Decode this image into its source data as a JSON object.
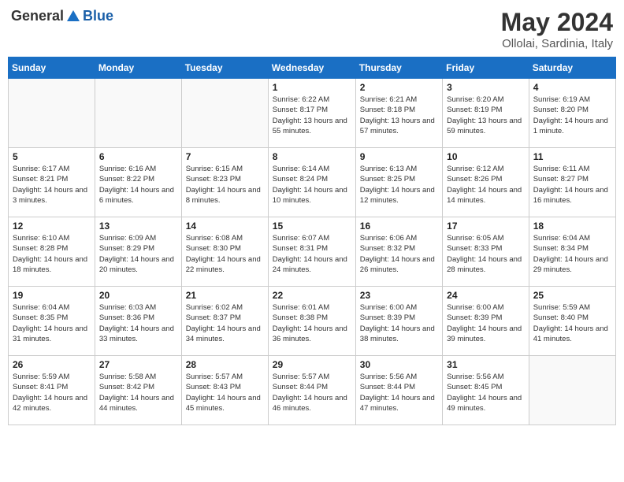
{
  "header": {
    "logo_general": "General",
    "logo_blue": "Blue",
    "month_year": "May 2024",
    "location": "Ollolai, Sardinia, Italy"
  },
  "weekdays": [
    "Sunday",
    "Monday",
    "Tuesday",
    "Wednesday",
    "Thursday",
    "Friday",
    "Saturday"
  ],
  "weeks": [
    [
      null,
      null,
      null,
      {
        "day": "1",
        "sunrise": "Sunrise: 6:22 AM",
        "sunset": "Sunset: 8:17 PM",
        "daylight": "Daylight: 13 hours and 55 minutes."
      },
      {
        "day": "2",
        "sunrise": "Sunrise: 6:21 AM",
        "sunset": "Sunset: 8:18 PM",
        "daylight": "Daylight: 13 hours and 57 minutes."
      },
      {
        "day": "3",
        "sunrise": "Sunrise: 6:20 AM",
        "sunset": "Sunset: 8:19 PM",
        "daylight": "Daylight: 13 hours and 59 minutes."
      },
      {
        "day": "4",
        "sunrise": "Sunrise: 6:19 AM",
        "sunset": "Sunset: 8:20 PM",
        "daylight": "Daylight: 14 hours and 1 minute."
      }
    ],
    [
      {
        "day": "5",
        "sunrise": "Sunrise: 6:17 AM",
        "sunset": "Sunset: 8:21 PM",
        "daylight": "Daylight: 14 hours and 3 minutes."
      },
      {
        "day": "6",
        "sunrise": "Sunrise: 6:16 AM",
        "sunset": "Sunset: 8:22 PM",
        "daylight": "Daylight: 14 hours and 6 minutes."
      },
      {
        "day": "7",
        "sunrise": "Sunrise: 6:15 AM",
        "sunset": "Sunset: 8:23 PM",
        "daylight": "Daylight: 14 hours and 8 minutes."
      },
      {
        "day": "8",
        "sunrise": "Sunrise: 6:14 AM",
        "sunset": "Sunset: 8:24 PM",
        "daylight": "Daylight: 14 hours and 10 minutes."
      },
      {
        "day": "9",
        "sunrise": "Sunrise: 6:13 AM",
        "sunset": "Sunset: 8:25 PM",
        "daylight": "Daylight: 14 hours and 12 minutes."
      },
      {
        "day": "10",
        "sunrise": "Sunrise: 6:12 AM",
        "sunset": "Sunset: 8:26 PM",
        "daylight": "Daylight: 14 hours and 14 minutes."
      },
      {
        "day": "11",
        "sunrise": "Sunrise: 6:11 AM",
        "sunset": "Sunset: 8:27 PM",
        "daylight": "Daylight: 14 hours and 16 minutes."
      }
    ],
    [
      {
        "day": "12",
        "sunrise": "Sunrise: 6:10 AM",
        "sunset": "Sunset: 8:28 PM",
        "daylight": "Daylight: 14 hours and 18 minutes."
      },
      {
        "day": "13",
        "sunrise": "Sunrise: 6:09 AM",
        "sunset": "Sunset: 8:29 PM",
        "daylight": "Daylight: 14 hours and 20 minutes."
      },
      {
        "day": "14",
        "sunrise": "Sunrise: 6:08 AM",
        "sunset": "Sunset: 8:30 PM",
        "daylight": "Daylight: 14 hours and 22 minutes."
      },
      {
        "day": "15",
        "sunrise": "Sunrise: 6:07 AM",
        "sunset": "Sunset: 8:31 PM",
        "daylight": "Daylight: 14 hours and 24 minutes."
      },
      {
        "day": "16",
        "sunrise": "Sunrise: 6:06 AM",
        "sunset": "Sunset: 8:32 PM",
        "daylight": "Daylight: 14 hours and 26 minutes."
      },
      {
        "day": "17",
        "sunrise": "Sunrise: 6:05 AM",
        "sunset": "Sunset: 8:33 PM",
        "daylight": "Daylight: 14 hours and 28 minutes."
      },
      {
        "day": "18",
        "sunrise": "Sunrise: 6:04 AM",
        "sunset": "Sunset: 8:34 PM",
        "daylight": "Daylight: 14 hours and 29 minutes."
      }
    ],
    [
      {
        "day": "19",
        "sunrise": "Sunrise: 6:04 AM",
        "sunset": "Sunset: 8:35 PM",
        "daylight": "Daylight: 14 hours and 31 minutes."
      },
      {
        "day": "20",
        "sunrise": "Sunrise: 6:03 AM",
        "sunset": "Sunset: 8:36 PM",
        "daylight": "Daylight: 14 hours and 33 minutes."
      },
      {
        "day": "21",
        "sunrise": "Sunrise: 6:02 AM",
        "sunset": "Sunset: 8:37 PM",
        "daylight": "Daylight: 14 hours and 34 minutes."
      },
      {
        "day": "22",
        "sunrise": "Sunrise: 6:01 AM",
        "sunset": "Sunset: 8:38 PM",
        "daylight": "Daylight: 14 hours and 36 minutes."
      },
      {
        "day": "23",
        "sunrise": "Sunrise: 6:00 AM",
        "sunset": "Sunset: 8:39 PM",
        "daylight": "Daylight: 14 hours and 38 minutes."
      },
      {
        "day": "24",
        "sunrise": "Sunrise: 6:00 AM",
        "sunset": "Sunset: 8:39 PM",
        "daylight": "Daylight: 14 hours and 39 minutes."
      },
      {
        "day": "25",
        "sunrise": "Sunrise: 5:59 AM",
        "sunset": "Sunset: 8:40 PM",
        "daylight": "Daylight: 14 hours and 41 minutes."
      }
    ],
    [
      {
        "day": "26",
        "sunrise": "Sunrise: 5:59 AM",
        "sunset": "Sunset: 8:41 PM",
        "daylight": "Daylight: 14 hours and 42 minutes."
      },
      {
        "day": "27",
        "sunrise": "Sunrise: 5:58 AM",
        "sunset": "Sunset: 8:42 PM",
        "daylight": "Daylight: 14 hours and 44 minutes."
      },
      {
        "day": "28",
        "sunrise": "Sunrise: 5:57 AM",
        "sunset": "Sunset: 8:43 PM",
        "daylight": "Daylight: 14 hours and 45 minutes."
      },
      {
        "day": "29",
        "sunrise": "Sunrise: 5:57 AM",
        "sunset": "Sunset: 8:44 PM",
        "daylight": "Daylight: 14 hours and 46 minutes."
      },
      {
        "day": "30",
        "sunrise": "Sunrise: 5:56 AM",
        "sunset": "Sunset: 8:44 PM",
        "daylight": "Daylight: 14 hours and 47 minutes."
      },
      {
        "day": "31",
        "sunrise": "Sunrise: 5:56 AM",
        "sunset": "Sunset: 8:45 PM",
        "daylight": "Daylight: 14 hours and 49 minutes."
      },
      null
    ]
  ]
}
